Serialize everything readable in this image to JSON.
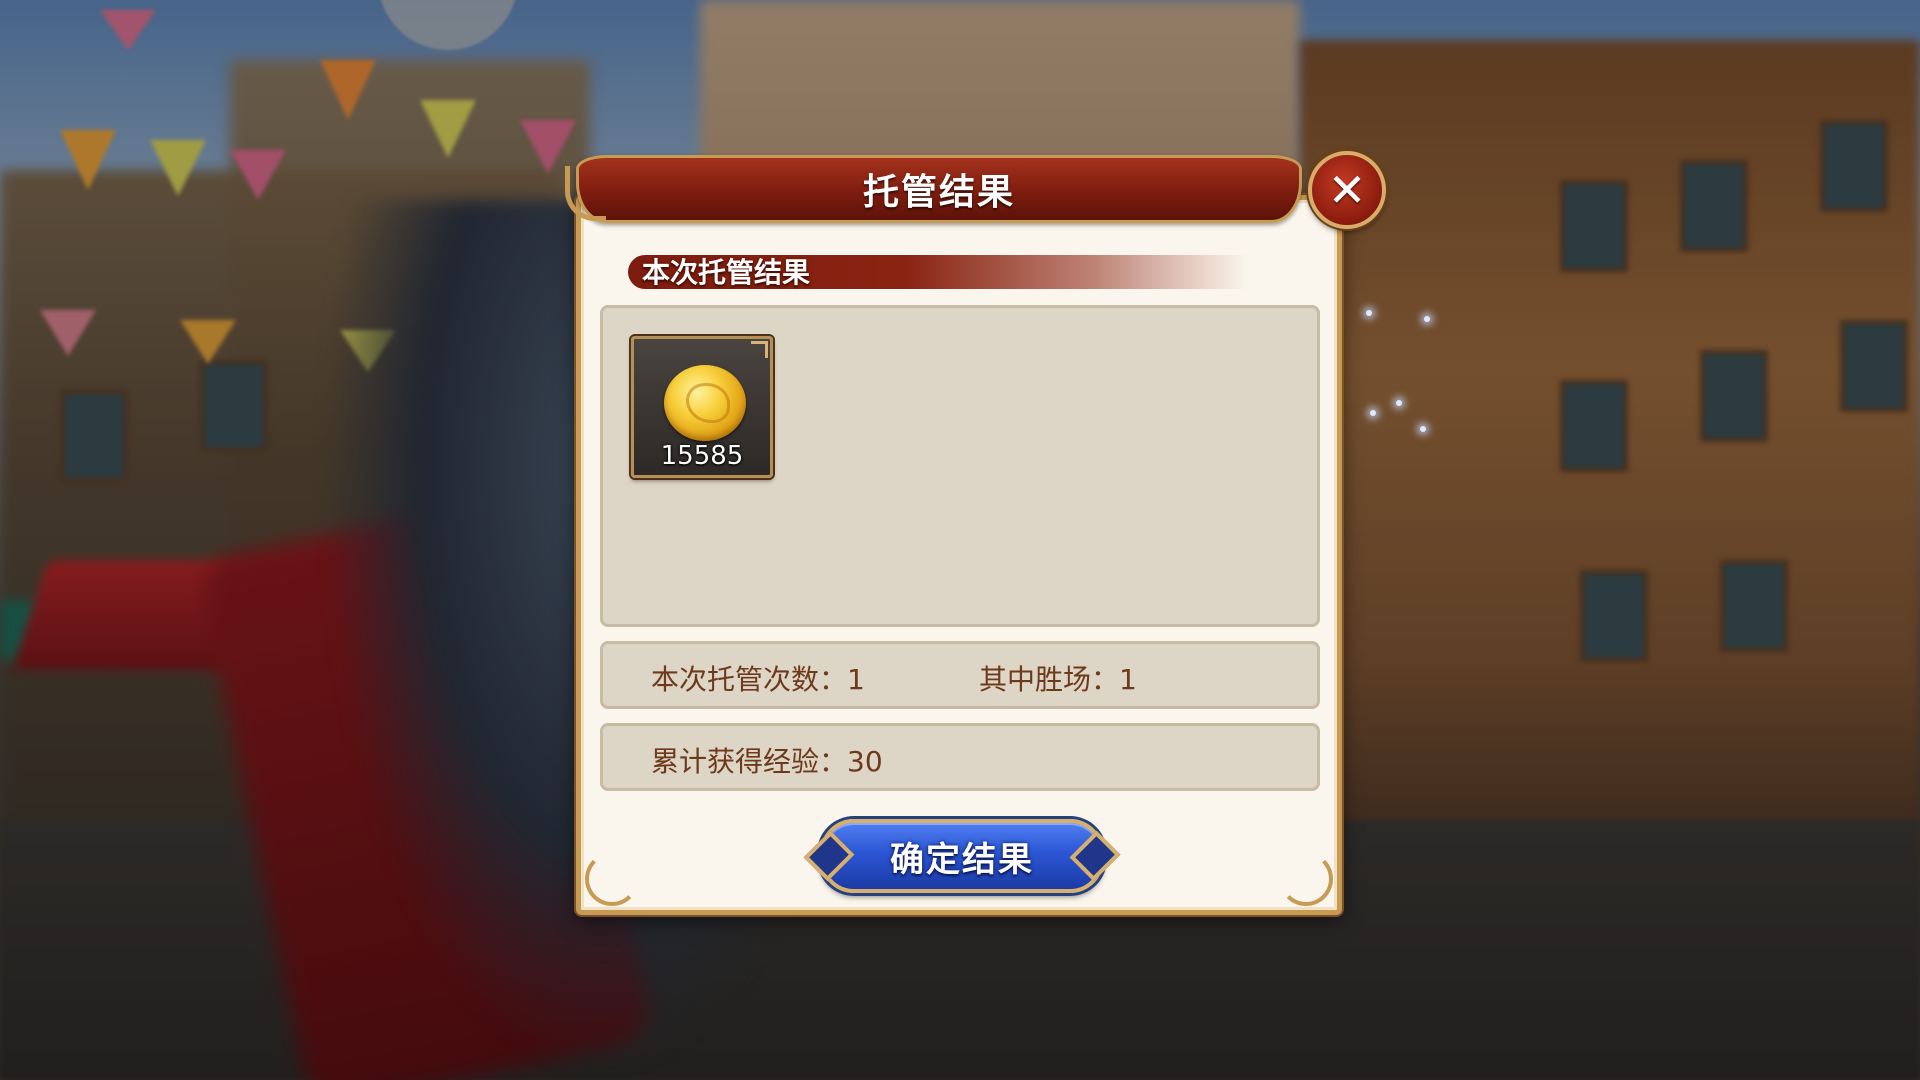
{
  "dialog": {
    "title": "托管结果",
    "close_icon": "close-icon",
    "section_header": "本次托管结果",
    "reward_items": [
      {
        "icon": "gold-coin-icon",
        "count": "15585"
      }
    ],
    "stats": {
      "times_label": "本次托管次数：1",
      "wins_label": "其中胜场：1",
      "exp_label": "累计获得经验：30"
    },
    "confirm_label": "确定结果"
  },
  "colors": {
    "title_bar": "#8a2412",
    "panel_bg": "#fbf6ed",
    "frame_gold": "#c89b55",
    "text_brown": "#6e3a1c",
    "confirm_blue": "#2c56d4"
  }
}
